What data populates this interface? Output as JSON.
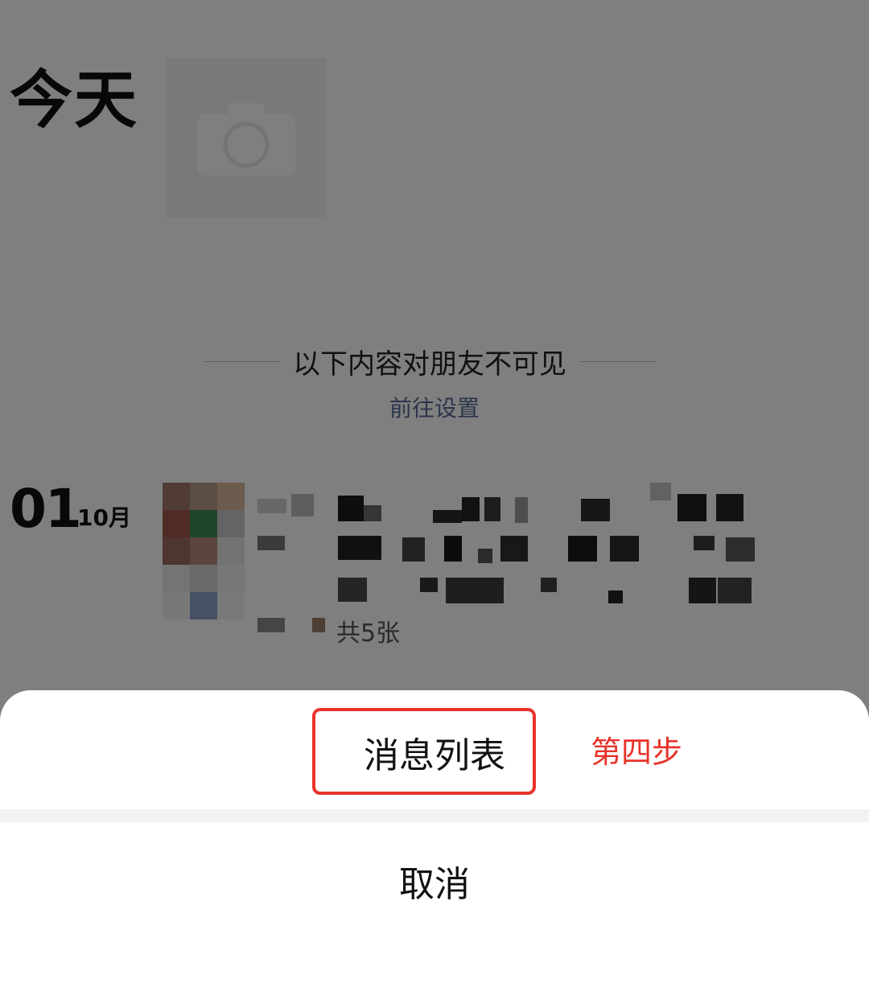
{
  "header": {
    "title": "今天"
  },
  "privacy": {
    "notice": "以下内容对朋友不可见",
    "settings_link": "前往设置"
  },
  "post": {
    "day": "01",
    "month": "10月",
    "image_count": "共5张"
  },
  "sheet": {
    "option_label": "消息列表",
    "cancel_label": "取消"
  },
  "annotation": {
    "step_label": "第四步",
    "color": "#e8332a"
  },
  "icons": {
    "camera": "camera-icon"
  }
}
